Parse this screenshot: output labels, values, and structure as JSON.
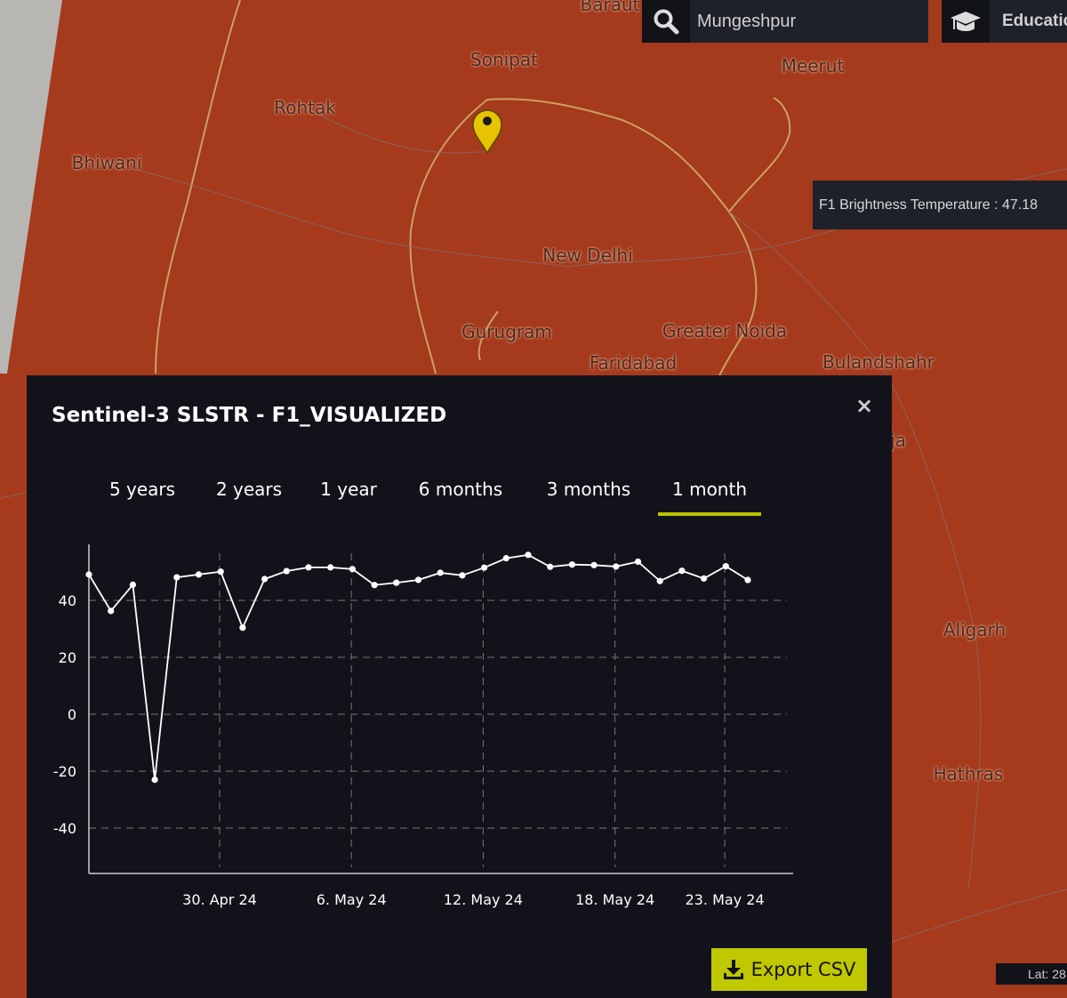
{
  "map": {
    "cities": [
      {
        "name": "Baraut"
      },
      {
        "name": "Sonipat"
      },
      {
        "name": "Meerut"
      },
      {
        "name": "Rohtak"
      },
      {
        "name": "Bhiwani"
      },
      {
        "name": "New Delhi"
      },
      {
        "name": "Gurugram"
      },
      {
        "name": "Greater Noida"
      },
      {
        "name": "Faridabad"
      },
      {
        "name": "Bulandshahr"
      },
      {
        "name": "ja"
      },
      {
        "name": "Aligarh"
      },
      {
        "name": "Hathras"
      }
    ],
    "marker_icon": "map-pin-icon",
    "marker_color": "#e8c400",
    "tooltip": "F1 Brightness Temperature : 47.18",
    "lat_readout": "Lat: 28"
  },
  "search": {
    "icon": "search-icon",
    "value": "Mungeshpur"
  },
  "education": {
    "icon": "graduation-cap-icon",
    "label": "Education"
  },
  "panel": {
    "title": "Sentinel-3 SLSTR - F1_VISUALIZED",
    "close_label": "×",
    "tabs": [
      {
        "label": "5 years"
      },
      {
        "label": "2 years"
      },
      {
        "label": "1 year"
      },
      {
        "label": "6 months"
      },
      {
        "label": "3 months"
      },
      {
        "label": "1 month",
        "active": true
      }
    ],
    "accent_color": "#b9c400",
    "export_label": "Export CSV",
    "export_icon": "download-icon"
  },
  "chart_data": {
    "type": "line",
    "title": "",
    "xlabel": "",
    "ylabel": "",
    "x_ticks": [
      "30. Apr 24",
      "6. May 24",
      "12. May 24",
      "18. May 24",
      "23. May 24"
    ],
    "x_tick_dates": [
      "2024-04-30",
      "2024-05-06",
      "2024-05-12",
      "2024-05-18",
      "2024-05-23"
    ],
    "y_ticks": [
      40,
      20,
      0,
      -20,
      -40
    ],
    "ylim": [
      -55,
      60
    ],
    "grid": true,
    "x": [
      "2024-04-24",
      "2024-04-25",
      "2024-04-26",
      "2024-04-27",
      "2024-04-28",
      "2024-04-29",
      "2024-04-30",
      "2024-05-01",
      "2024-05-02",
      "2024-05-03",
      "2024-05-04",
      "2024-05-05",
      "2024-05-06",
      "2024-05-07",
      "2024-05-08",
      "2024-05-09",
      "2024-05-10",
      "2024-05-11",
      "2024-05-12",
      "2024-05-13",
      "2024-05-14",
      "2024-05-15",
      "2024-05-16",
      "2024-05-17",
      "2024-05-18",
      "2024-05-19",
      "2024-05-20",
      "2024-05-21",
      "2024-05-22",
      "2024-05-23",
      "2024-05-24"
    ],
    "values": [
      49.1,
      36.3,
      45.5,
      -23.0,
      48.1,
      49.1,
      50.1,
      30.4,
      47.5,
      50.3,
      51.6,
      51.6,
      51.0,
      45.4,
      46.2,
      47.2,
      49.7,
      48.8,
      51.5,
      54.8,
      56.0,
      51.8,
      52.6,
      52.4,
      51.9,
      53.6,
      46.8,
      50.4,
      47.7,
      52.0,
      47.18
    ]
  }
}
